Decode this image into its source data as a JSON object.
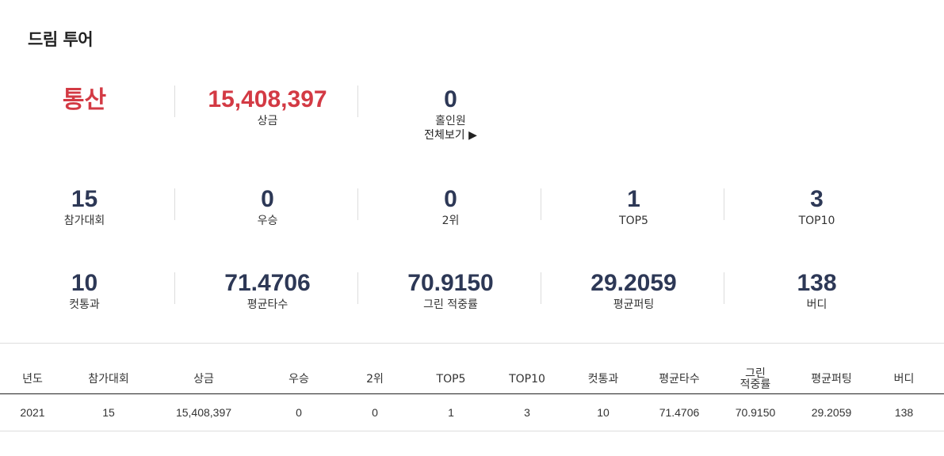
{
  "title": "드림 투어",
  "summary": {
    "label": "통산",
    "prize": {
      "value": "15,408,397",
      "label": "상금"
    },
    "hole_in_one": {
      "value": "0",
      "label": "홀인원",
      "link": "전체보기 ▶"
    }
  },
  "stats_row1": [
    {
      "value": "15",
      "label": "참가대회"
    },
    {
      "value": "0",
      "label": "우승"
    },
    {
      "value": "0",
      "label": "2위"
    },
    {
      "value": "1",
      "label": "TOP5"
    },
    {
      "value": "3",
      "label": "TOP10"
    }
  ],
  "stats_row2": [
    {
      "value": "10",
      "label": "컷통과"
    },
    {
      "value": "71.4706",
      "label": "평균타수"
    },
    {
      "value": "70.9150",
      "label": "그린 적중률"
    },
    {
      "value": "29.2059",
      "label": "평균퍼팅"
    },
    {
      "value": "138",
      "label": "버디"
    }
  ],
  "table": {
    "headers": [
      "년도",
      "참가대회",
      "상금",
      "우승",
      "2위",
      "TOP5",
      "TOP10",
      "컷통과",
      "평균타수",
      "그린",
      "평균퍼팅",
      "버디"
    ],
    "header_green_line2": "적중률",
    "rows": [
      [
        "2021",
        "15",
        "15,408,397",
        "0",
        "0",
        "1",
        "3",
        "10",
        "71.4706",
        "70.9150",
        "29.2059",
        "138"
      ]
    ]
  },
  "colors": {
    "accent_red": "#d33a44",
    "number_navy": "#2d3856"
  }
}
